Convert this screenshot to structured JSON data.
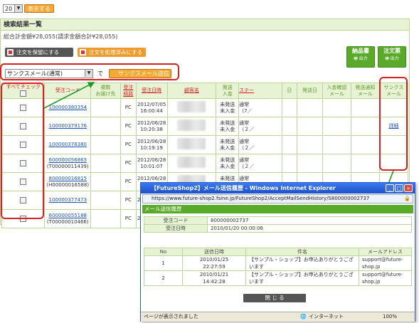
{
  "top": {
    "page_size": "20",
    "show_button": "表示する"
  },
  "section": {
    "title": "検索結果一覧",
    "total": "総合計金額¥28,055(請求金額合計¥28,055)",
    "btn_hold": "注文を保留にする",
    "btn_processed": "注文を処理済みにする",
    "mail_select": "サンクスメール(通常)",
    "de": "で",
    "btn_send": "サンクスメール送信",
    "btn_invoice": "納品書",
    "btn_invoice_sub": "出力",
    "btn_order_sheet": "注文票",
    "btn_order_sheet_sub": "出力"
  },
  "table": {
    "headers": {
      "check_all": "すべてチェック",
      "order_code": "受注コード",
      "multi_1": "複数",
      "multi_2": "お届け先",
      "customer_1": "受注",
      "customer_2": "経路",
      "order_date": "受注日時",
      "customer_name": "顧客名",
      "ship_1": "発送",
      "ship_2": "入金",
      "status": "ステー",
      "col_date": "日",
      "ship_date": "発送日",
      "pay_mail_1": "入金確認",
      "pay_mail_2": "メール",
      "ship_mail_1": "発送通知",
      "ship_mail_2": "メール",
      "thanks_1": "サンクス",
      "thanks_2": "メール"
    },
    "rows": [
      {
        "code": "100000380354",
        "sub": "",
        "route": "PC",
        "date1": "2012/07/05",
        "date2": "16:00:44",
        "s1": "未発送",
        "s2": "未入金",
        "st1": "通常",
        "st2": "（7／",
        "thanks": ""
      },
      {
        "code": "100000379176",
        "sub": "",
        "route": "PC",
        "date1": "2012/06/28",
        "date2": "10:20:38",
        "s1": "未発送",
        "s2": "未入金",
        "st1": "通常",
        "st2": "（２／",
        "thanks": "詳細"
      },
      {
        "code": "100000378380",
        "sub": "",
        "route": "PC",
        "date1": "2012/06/28",
        "date2": "10:19:19",
        "s1": "未発送",
        "s2": "未入金",
        "st1": "通常",
        "st2": "（２／",
        "thanks": ""
      },
      {
        "code": "600000056863",
        "sub": "(T00000011439)",
        "route": "PC",
        "date1": "2012/06/28",
        "date2": "10:01:07",
        "s1": "未発送",
        "s2": "未入金",
        "st1": "通常",
        "st2": "（２／",
        "thanks": ""
      },
      {
        "code": "800000016815",
        "sub": "(H00000016588)",
        "route": "PC",
        "date1": "2012/06/28",
        "date2": "10:01:05",
        "s1": "未発送",
        "s2": "未入金",
        "st1": "通常",
        "st2": "（55／",
        "thanks": ""
      },
      {
        "code": "100000377473",
        "sub": "",
        "route": "PC",
        "date1": "2012/06/28",
        "date2": "",
        "s1": "未発送",
        "s2": "",
        "st1": "通常",
        "st2": "",
        "thanks": ""
      },
      {
        "code": "600000055188",
        "sub": "(T00000010466)",
        "route": "PC",
        "date1": "2012/06/28",
        "date2": "",
        "s1": "",
        "s2": "",
        "st1": "",
        "st2": "",
        "thanks": ""
      }
    ]
  },
  "popup": {
    "window_title": "【FutureShop2】メール送信履歴 - Windows Internet Explorer",
    "address": "https://www.future-shop2.fsine.jp/FutureShop2/AcceptMailSendHistory/S800000002737",
    "header": "メール送信履歴",
    "order_code_label": "受注コード",
    "order_code": "800000002737",
    "order_date_label": "受注日時",
    "order_date": "2010/01/20 00:00:06",
    "cols": {
      "no": "No",
      "sent": "送信日時",
      "subject": "件名",
      "mail": "メールアドレス"
    },
    "rows": [
      {
        "no": "1",
        "date": "2010/01/25",
        "time": "22:27:59",
        "subject1": "【サンプル・ショップ】お申込ありがとうござ",
        "subject2": "います",
        "mail1": "support@future-",
        "mail2": "shop.jp"
      },
      {
        "no": "2",
        "date": "2010/01/21",
        "time": "14:42:28",
        "subject1": "【サンプル・ショップ】お申込ありがとうござ",
        "subject2": "います",
        "mail1": "support@future-",
        "mail2": "shop.jp"
      }
    ],
    "close": "閉 じ る",
    "status_left": "ページが表示されました",
    "status_zone": "インターネット",
    "zoom": "100%"
  }
}
